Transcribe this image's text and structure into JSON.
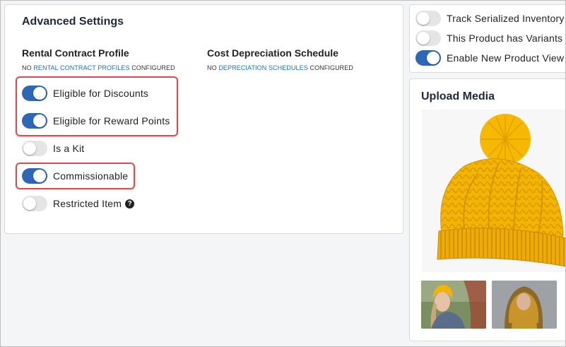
{
  "advanced": {
    "title": "Advanced Settings",
    "rental": {
      "heading": "Rental Contract Profile",
      "note_prefix": "NO",
      "note_link": "RENTAL CONTRACT PROFILES",
      "note_suffix": "CONFIGURED"
    },
    "depreciation": {
      "heading": "Cost Depreciation Schedule",
      "note_prefix": "NO",
      "note_link": "DEPRECIATION SCHEDULES",
      "note_suffix": "CONFIGURED"
    },
    "toggles": [
      {
        "label": "Eligible for Discounts",
        "on": true
      },
      {
        "label": "Eligible for Reward Points",
        "on": true
      },
      {
        "label": "Is a Kit",
        "on": false
      },
      {
        "label": "Commissionable",
        "on": true
      },
      {
        "label": "Restricted Item",
        "on": false
      }
    ],
    "help_glyph": "?"
  },
  "product_options": {
    "toggles": [
      {
        "label": "Track Serialized Inventory",
        "on": false
      },
      {
        "label": "This Product has Variants",
        "on": false
      },
      {
        "label": "Enable New Product View",
        "on": true
      }
    ]
  },
  "media": {
    "title": "Upload Media",
    "main_image": "yellow-knit-beanie",
    "thumbnails": [
      "woman-wearing-yellow-beanie",
      "man-wearing-yellow-hood"
    ]
  },
  "colors": {
    "toggle_on": "#2d68b8",
    "toggle_off": "#e5e5e5",
    "highlight": "#e04a4f",
    "link": "#1f6fb5",
    "yarn": "#f4b400"
  }
}
